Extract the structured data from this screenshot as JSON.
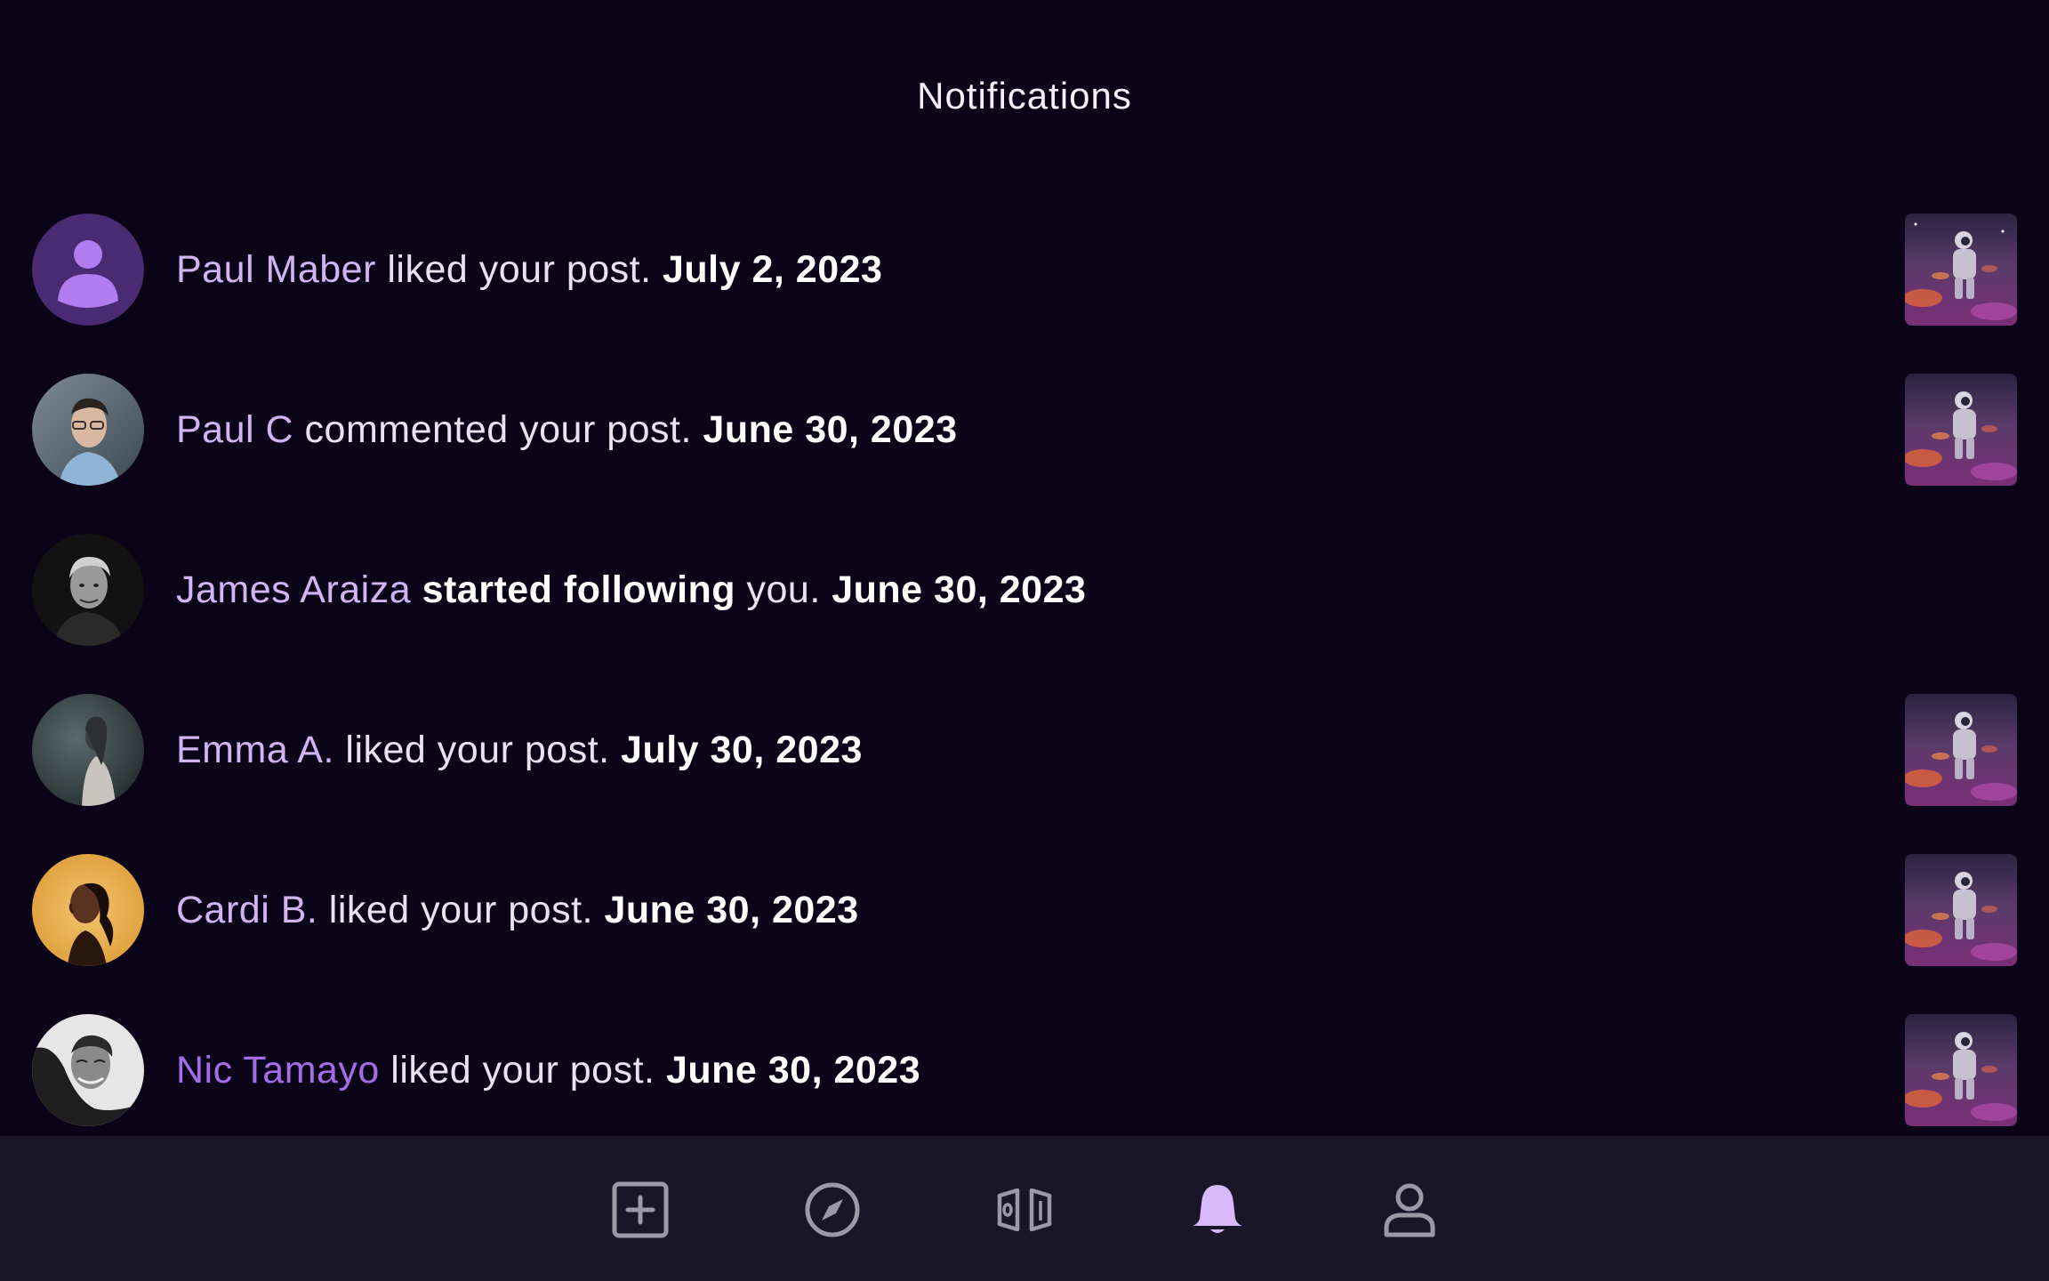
{
  "header": {
    "title": "Notifications"
  },
  "notifications": [
    {
      "name": "Paul Maber",
      "action": " liked your post. ",
      "action_bold": "",
      "action_tail": "",
      "date": "July 2, 2023",
      "avatar_icon": "default-user-icon",
      "has_thumbnail": true
    },
    {
      "name": "Paul C",
      "action": " commented your post. ",
      "action_bold": "",
      "action_tail": "",
      "date": "June 30, 2023",
      "avatar_icon": "photo",
      "has_thumbnail": true
    },
    {
      "name": "James Araiza",
      "action": " ",
      "action_bold": "started following",
      "action_tail": " you. ",
      "date": "June 30, 2023",
      "avatar_icon": "photo",
      "has_thumbnail": false
    },
    {
      "name": "Emma A.",
      "action": " liked your post. ",
      "action_bold": "",
      "action_tail": "",
      "date": "July 30, 2023",
      "avatar_icon": "photo",
      "has_thumbnail": true
    },
    {
      "name": "Cardi B.",
      "action": " liked your post. ",
      "action_bold": "",
      "action_tail": "",
      "date": "June 30, 2023",
      "avatar_icon": "photo",
      "has_thumbnail": true
    },
    {
      "name": "Nic Tamayo",
      "action": " liked your post. ",
      "action_bold": "",
      "action_tail": "",
      "date": "June 30, 2023",
      "avatar_icon": "photo",
      "has_thumbnail": true
    }
  ],
  "bottom_nav": {
    "items": [
      {
        "icon": "add-post-icon"
      },
      {
        "icon": "explore-compass-icon"
      },
      {
        "icon": "gallery-icon"
      },
      {
        "icon": "bell-icon",
        "active": true
      },
      {
        "icon": "profile-icon"
      }
    ]
  },
  "colors": {
    "background": "#0b0418",
    "nav_background": "#181628",
    "name_accent": "#d2b4f2",
    "active_icon": "#d8b8f8",
    "inactive_icon": "#9c98a6"
  }
}
